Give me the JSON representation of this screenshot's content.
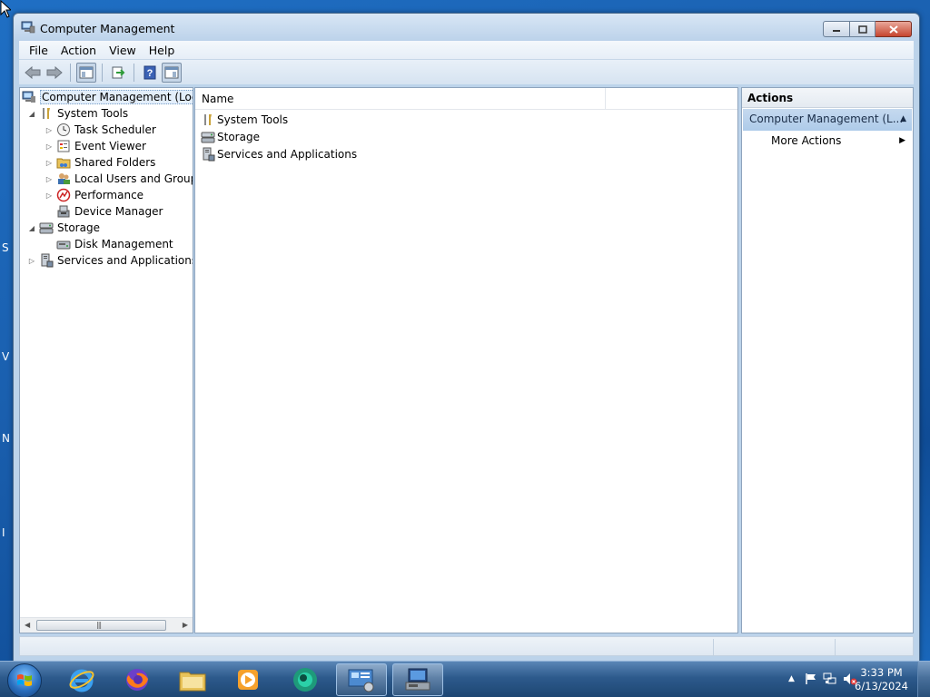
{
  "window": {
    "title": "Computer Management",
    "min_icon": "minimize-icon",
    "max_icon": "maximize-icon",
    "close_icon": "close-icon"
  },
  "menu": [
    "File",
    "Action",
    "View",
    "Help"
  ],
  "tree": {
    "root": "Computer Management (Local",
    "system_tools": "System Tools",
    "task_scheduler": "Task Scheduler",
    "event_viewer": "Event Viewer",
    "shared_folders": "Shared Folders",
    "local_users": "Local Users and Groups",
    "performance": "Performance",
    "device_manager": "Device Manager",
    "storage": "Storage",
    "disk_management": "Disk Management",
    "services": "Services and Applications"
  },
  "list": {
    "column_name": "Name",
    "items": [
      "System Tools",
      "Storage",
      "Services and Applications"
    ]
  },
  "actions": {
    "title": "Actions",
    "section": "Computer Management (L...",
    "more_actions": "More Actions"
  },
  "taskbar": {
    "time": "3:33 PM",
    "date": "6/13/2024"
  },
  "desktop_peek": [
    "S",
    "V",
    "N",
    "I"
  ]
}
